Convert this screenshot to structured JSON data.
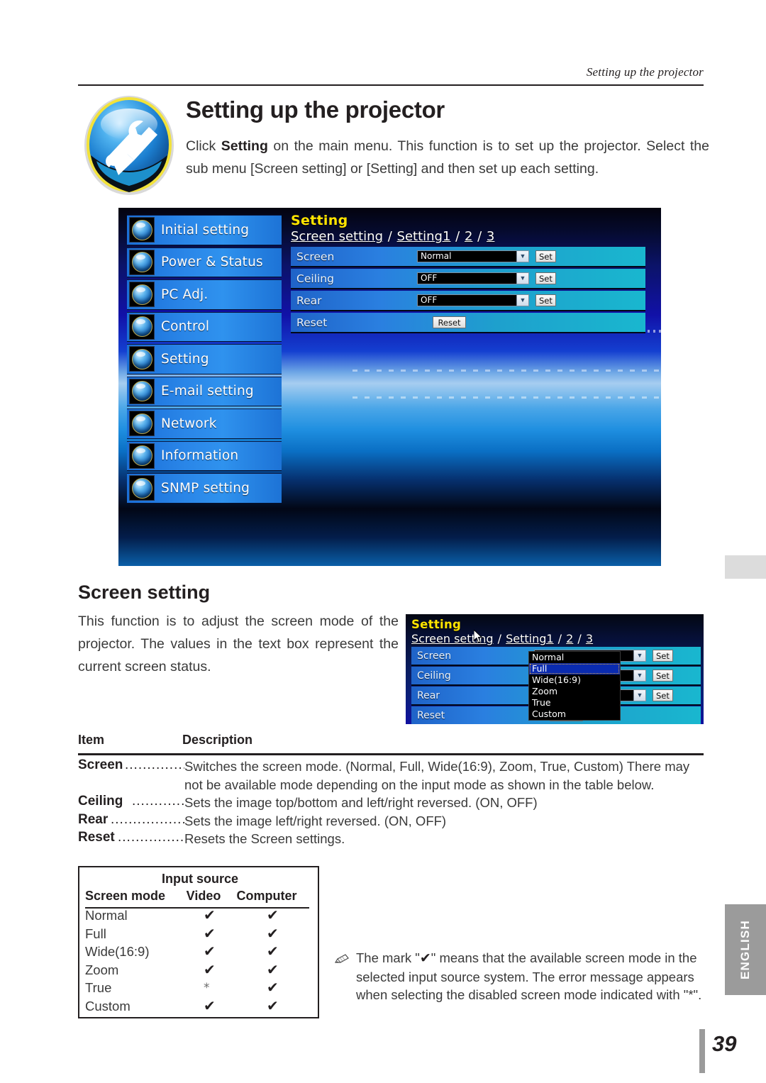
{
  "running_head": "Setting up the projector",
  "page_title": "Setting up the projector",
  "intro": {
    "before": "Click ",
    "bold": "Setting",
    "after": " on the main menu. This function is to set up the projector. Select the sub menu [Screen setting] or [Setting] and then set up each setting."
  },
  "screenshot1": {
    "nav_items": [
      {
        "label": "Initial setting",
        "icon": "initial-setting-icon"
      },
      {
        "label": "Power & Status",
        "icon": "power-status-icon"
      },
      {
        "label": "PC Adj.",
        "icon": "pc-adj-icon"
      },
      {
        "label": "Control",
        "icon": "control-icon"
      },
      {
        "label": "Setting",
        "icon": "setting-icon"
      },
      {
        "label": "E-mail setting",
        "icon": "email-setting-icon"
      },
      {
        "label": "Network",
        "icon": "network-icon"
      },
      {
        "label": "Information",
        "icon": "information-icon"
      },
      {
        "label": "SNMP setting",
        "icon": "snmp-setting-icon"
      }
    ],
    "panel_title": "Setting",
    "breadcrumb": {
      "active": "Screen setting",
      "links": [
        "Setting1",
        "2",
        "3"
      ],
      "separator": " / "
    },
    "rows": [
      {
        "label": "Screen",
        "value": "Normal",
        "button": "Set"
      },
      {
        "label": "Ceiling",
        "value": "OFF",
        "button": "Set"
      },
      {
        "label": "Rear",
        "value": "OFF",
        "button": "Set"
      },
      {
        "label": "Reset",
        "value": null,
        "button": "Reset"
      }
    ]
  },
  "screen_setting": {
    "heading": "Screen setting",
    "body": "This function is to adjust the screen mode of the projector.  The values in the text box represent the current screen status."
  },
  "screenshot2": {
    "panel_title": "Setting",
    "breadcrumb": {
      "active": "Screen setting",
      "links": [
        "Setting1",
        "2",
        "3"
      ],
      "separator": " / "
    },
    "rows": [
      {
        "label": "Screen",
        "value": "Normal",
        "button": "Set"
      },
      {
        "label": "Ceiling",
        "value": "",
        "button": "Set"
      },
      {
        "label": "Rear",
        "value": "",
        "button": "Set"
      },
      {
        "label": "Reset",
        "value": null,
        "button": "Reset"
      }
    ],
    "dropdown": {
      "options": [
        "Normal",
        "Full",
        "Wide(16:9)",
        "Zoom",
        "True",
        "Custom"
      ],
      "selected": "Full"
    }
  },
  "description_table": {
    "headers": {
      "item": "Item",
      "description": "Description"
    },
    "rows": [
      {
        "term": "Screen",
        "dots": "....................",
        "text": "Switches the screen mode. (Normal, Full, Wide(16:9), Zoom, True, Custom) There may not be available mode depending on the input mode as shown in the table below."
      },
      {
        "term": "Ceiling",
        "dots": "...................",
        "text": "Sets the image top/bottom and left/right reversed. (ON, OFF)"
      },
      {
        "term": "Rear",
        "dots": "........................",
        "text": "Sets the image left/right reversed. (ON, OFF)"
      },
      {
        "term": "Reset",
        "dots": ".......................",
        "text": "Resets the Screen settings."
      }
    ]
  },
  "source_table": {
    "group_header": "Input source",
    "col_mode": "Screen mode",
    "col_video": "Video",
    "col_computer": "Computer",
    "check_mark": "✔",
    "star_mark": "*",
    "rows": [
      {
        "mode": "Normal",
        "video": "✔",
        "computer": "✔"
      },
      {
        "mode": "Full",
        "video": "✔",
        "computer": "✔"
      },
      {
        "mode": "Wide(16:9)",
        "video": "✔",
        "computer": "✔"
      },
      {
        "mode": "Zoom",
        "video": "✔",
        "computer": "✔"
      },
      {
        "mode": "True",
        "video": "*",
        "computer": "✔"
      },
      {
        "mode": "Custom",
        "video": "✔",
        "computer": "✔"
      }
    ]
  },
  "note": {
    "part1": "The mark \"",
    "mark": "✔",
    "part2": "\" means that the available screen mode in the selected input source system. The error message appears when selecting the disabled screen mode indicated with \"*\"."
  },
  "english_tab": "ENGLISH",
  "page_number": "39",
  "colors": {
    "ink": "#231f20",
    "body_text": "#3a3a3a",
    "panel_title_yellow": "#ffe400",
    "nav_blue": "#2a86e8",
    "row_teal": "#19b7cf",
    "dropdown_selected": "#0a2bb0",
    "tab_gray": "#9b9b9b"
  }
}
